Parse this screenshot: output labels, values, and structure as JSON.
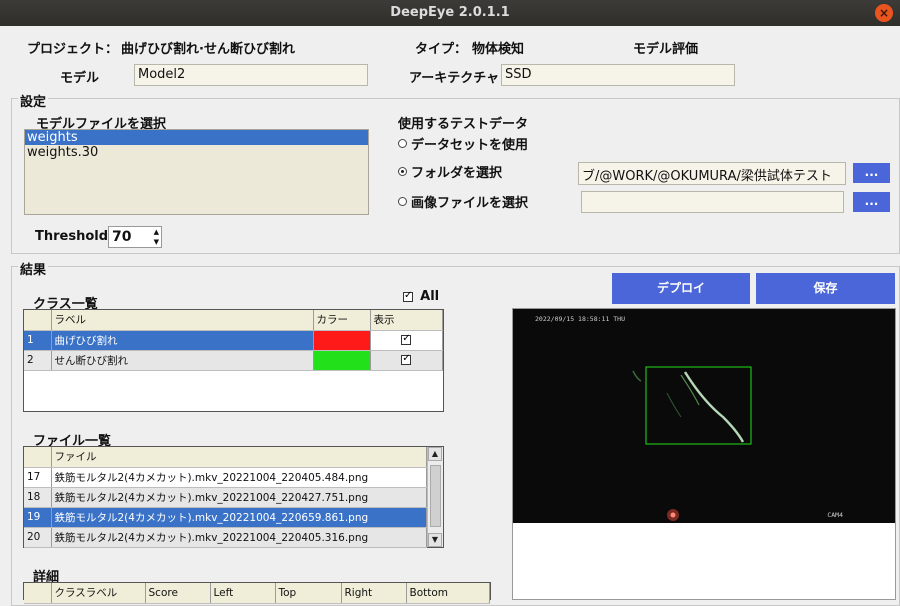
{
  "window": {
    "title": "DeepEye 2.0.1.1"
  },
  "header": {
    "project_label": "プロジェクト：",
    "project_value": "曲げひび割れ·せん断ひび割れ",
    "type_label": "タイプ：",
    "type_value": "物体検知",
    "mode_label": "モデル評価",
    "model_label": "モデル",
    "model_value": "Model2",
    "arch_label": "アーキテクチャ",
    "arch_value": "SSD"
  },
  "settings": {
    "title": "設定",
    "model_file_label": "モデルファイルを選択",
    "model_files": [
      "weights",
      "weights.30"
    ],
    "selected_model_index": 0,
    "threshold_label": "Threshold",
    "threshold_value": "70",
    "test_data_label": "使用するテストデータ",
    "options": [
      {
        "label": "データセットを使用",
        "selected": false
      },
      {
        "label": "フォルダを選択",
        "selected": true
      },
      {
        "label": "画像ファイルを選択",
        "selected": false
      }
    ],
    "folder_path": "ブ/@WORK/@OKUMURA/梁供試体テスト",
    "image_file_path": "",
    "browse_label": "..."
  },
  "results": {
    "title": "結果",
    "class_list_label": "クラス一覧",
    "all_label": "All",
    "all_checked": true,
    "class_columns": [
      "ラベル",
      "カラー",
      "表示"
    ],
    "classes": [
      {
        "index": "1",
        "label": "曲げひび割れ",
        "color": "#ff1a1a",
        "shown": true,
        "selected": true
      },
      {
        "index": "2",
        "label": "せん断ひび割れ",
        "color": "#22e01a",
        "shown": true,
        "selected": false
      }
    ],
    "file_list_label": "ファイル一覧",
    "file_column": "ファイル",
    "files": [
      {
        "index": "17",
        "name": "鉄筋モルタル2(4カメカット).mkv_20221004_220405.484.png",
        "selected": false
      },
      {
        "index": "18",
        "name": "鉄筋モルタル2(4カメカット).mkv_20221004_220427.751.png",
        "selected": false
      },
      {
        "index": "19",
        "name": "鉄筋モルタル2(4カメカット).mkv_20221004_220659.861.png",
        "selected": true
      },
      {
        "index": "20",
        "name": "鉄筋モルタル2(4カメカット).mkv_20221004_220405.316.png",
        "selected": false
      }
    ],
    "detail_label": "詳細",
    "detail_columns": [
      "クラスラベル",
      "Score",
      "Left",
      "Top",
      "Right",
      "Bottom"
    ],
    "deploy_label": "デプロイ",
    "save_label": "保存",
    "preview": {
      "timestamp": "2022/09/15 18:58:11 THU",
      "cam_label": "CAM4",
      "box_color": "#22e01a"
    }
  },
  "icons": {
    "close": "close-icon",
    "radio": "radio-icon",
    "checkbox": "checkbox-icon",
    "spin_up": "spin-up-icon",
    "spin_down": "spin-down-icon",
    "scroll_up": "scroll-up-icon",
    "scroll_down": "scroll-down-icon"
  }
}
